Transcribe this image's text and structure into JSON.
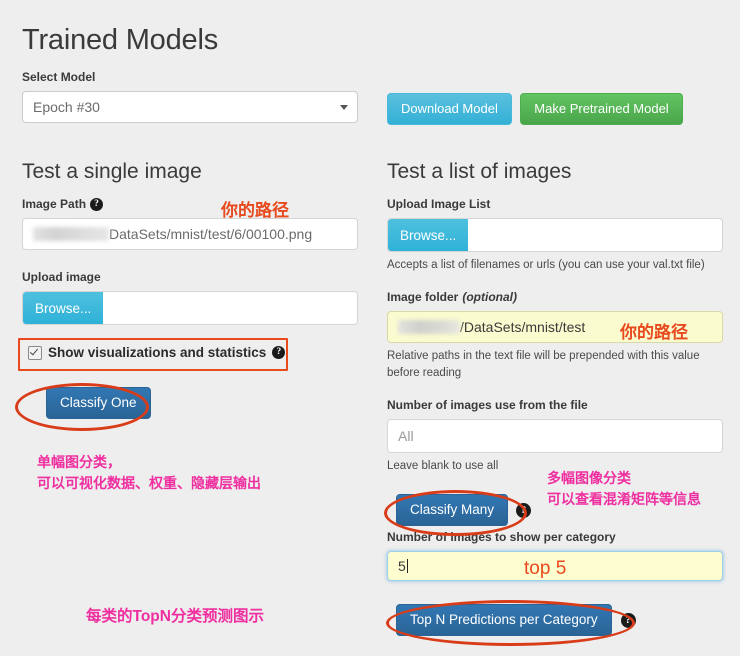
{
  "page": {
    "title": "Trained Models",
    "background_color": "#eeeeee"
  },
  "select_model": {
    "label": "Select Model",
    "value": "Epoch #30",
    "caret_icon": "chevron-down-icon"
  },
  "model_actions": {
    "download_label": "Download Model",
    "download_color": "#5bc0de",
    "pretrained_label": "Make Pretrained Model",
    "pretrained_color": "#5cb85c"
  },
  "single_image": {
    "heading": "Test a single image",
    "image_path_label": "Image Path",
    "image_path_help": "?",
    "image_path_value": "DataSets/mnist/test/6/00100.png",
    "upload_label": "Upload image",
    "browse_label": "Browse...",
    "browse_value": "",
    "show_viz_label": "Show visualizations and statistics",
    "show_viz_checked": true,
    "classify_one_label": "Classify One"
  },
  "image_list": {
    "heading": "Test a list of images",
    "upload_list_label": "Upload Image List",
    "browse_label": "Browse...",
    "browse_value": "",
    "upload_list_help": "Accepts a list of filenames or urls (you can use your val.txt file)",
    "image_folder_label": "Image folder",
    "image_folder_optional": "(optional)",
    "image_folder_value": "/DataSets/mnist/test",
    "image_folder_help": "Relative paths in the text file will be prepended with this value before reading",
    "num_images_label": "Number of images use from the file",
    "num_images_placeholder": "All",
    "num_images_help": "Leave blank to use all",
    "classify_many_label": "Classify Many",
    "num_per_category_label": "Number of images to show per category",
    "num_per_category_value": "5",
    "topn_button_label": "Top N Predictions per Category"
  },
  "annotations": {
    "path_cn_left": "你的路径",
    "path_cn_right": "你的路径",
    "single_note_line1": "单幅图分类，",
    "single_note_line2": "可以可视化数据、权重、隐藏层输出",
    "many_note_line1": "多幅图像分类",
    "many_note_line2": "可以查看混淆矩阵等信息",
    "top5_note": "top 5",
    "topn_note": "每类的TopN分类预测图示",
    "highlight_color": "#e8491d",
    "pink_color": "#ef2fa0"
  }
}
